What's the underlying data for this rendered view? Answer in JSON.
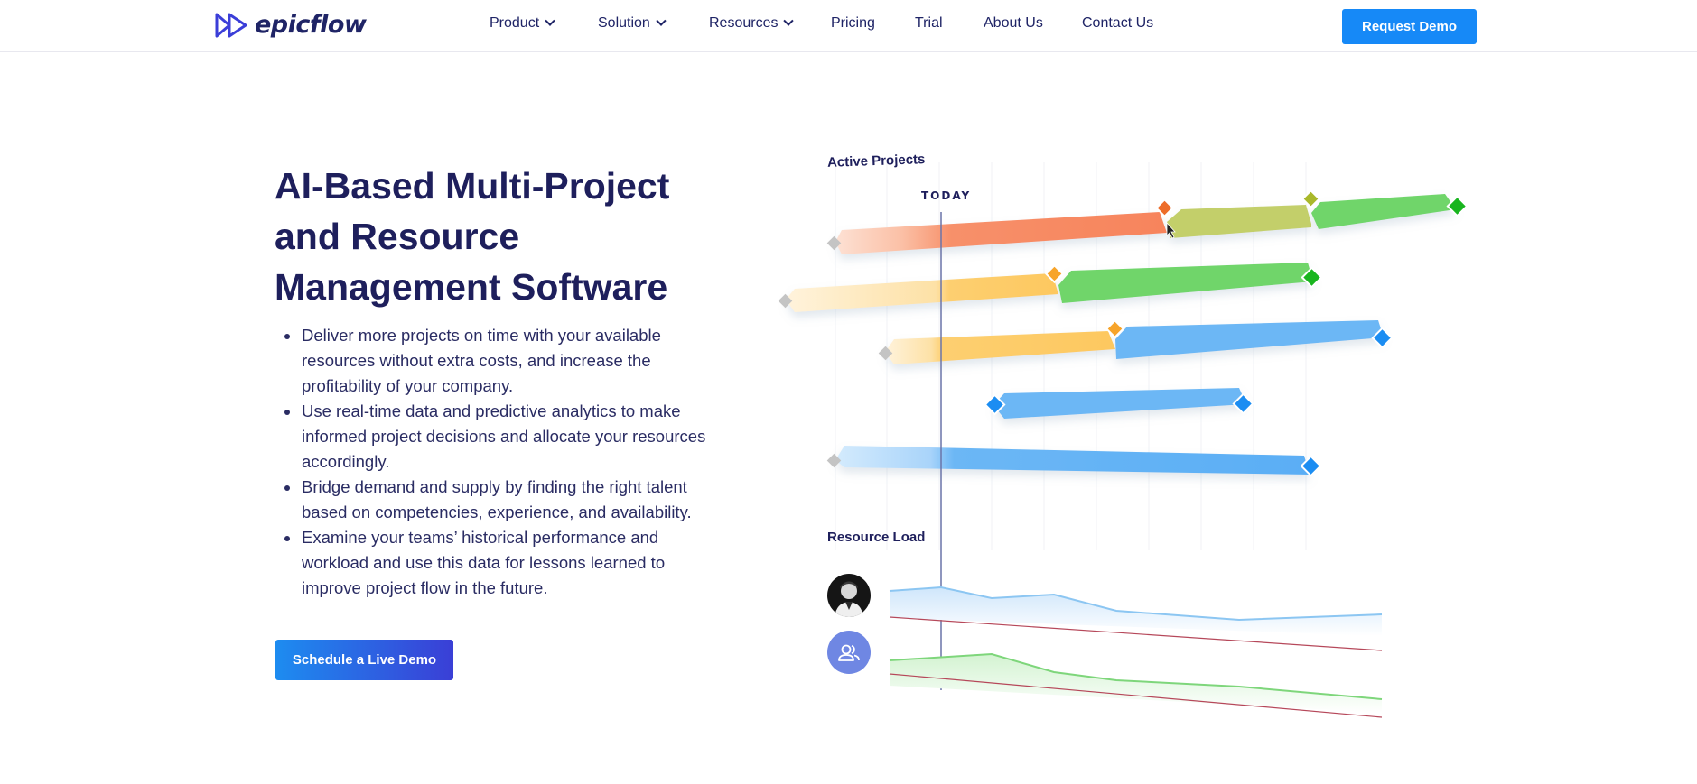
{
  "header": {
    "brand": "epicflow",
    "nav": [
      {
        "label": "Product",
        "dropdown": true
      },
      {
        "label": "Solution",
        "dropdown": true
      },
      {
        "label": "Resources",
        "dropdown": true
      },
      {
        "label": "Pricing",
        "dropdown": false
      },
      {
        "label": "Trial",
        "dropdown": false
      },
      {
        "label": "About Us",
        "dropdown": false
      },
      {
        "label": "Contact Us",
        "dropdown": false
      }
    ],
    "request_demo_label": "Request Demo"
  },
  "hero": {
    "title_lines": [
      "AI-Based Multi-Project",
      "and Resource",
      "Management Software"
    ],
    "bullets": [
      [
        "Deliver more projects on time with your available",
        "resources without extra costs, and increase the",
        "profitability of your company."
      ],
      [
        "Use real-time data and predictive analytics to make",
        "informed project decisions and allocate your resources",
        "accordingly."
      ],
      [
        "Bridge demand and supply by finding the right talent",
        "based on competencies, experience, and availability."
      ],
      [
        "Examine your teams’ historical performance and",
        "workload and use this data for lessons learned to",
        "improve project flow in the future."
      ]
    ],
    "cta_label": "Schedule a Live Demo"
  },
  "illustration": {
    "active_projects_label": "Active Projects",
    "today_label": "TODAY",
    "resource_load_label": "Resource Load"
  },
  "colors": {
    "brand_navy": "#1e1f5c",
    "button_blue": "#1689f7",
    "orange": "#f7845c",
    "yellow": "#fdc860",
    "green": "#5fd35c",
    "olive": "#c3cf6a",
    "blue": "#5aaef5"
  }
}
